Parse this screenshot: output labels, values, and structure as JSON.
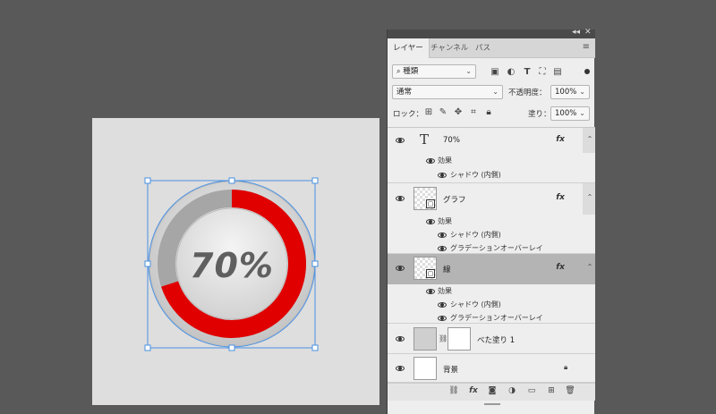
{
  "canvas": {
    "progress_text": "70%",
    "progress_fraction": 0.7,
    "ring_color": "#e00000",
    "track_color": "#a6a6a6"
  },
  "panel": {
    "collapse": "◂◂",
    "close": "✕",
    "tabs": [
      "レイヤー",
      "チャンネル",
      "パス"
    ],
    "menu_icon": "≡",
    "filter": {
      "label": "種類",
      "search_icon": "🔍"
    },
    "blend_mode": "通常",
    "opacity_label": "不透明度：",
    "opacity_value": "100%",
    "lock_label": "ロック：",
    "fill_label": "塗り：",
    "fill_value": "100%"
  },
  "layers": [
    {
      "name": "70%",
      "type_glyph": "T",
      "fx": "fx",
      "effects_label": "効果",
      "effects": [
        "シャドウ (内側)"
      ]
    },
    {
      "name": "グラフ",
      "fx": "fx",
      "effects_label": "効果",
      "effects": [
        "シャドウ (内側)",
        "グラデーションオーバーレイ"
      ]
    },
    {
      "name": "線",
      "fx": "fx",
      "effects_label": "効果",
      "effects": [
        "シャドウ (内側)",
        "グラデーションオーバーレイ"
      ]
    },
    {
      "name": "べた塗り 1"
    },
    {
      "name": "背景"
    }
  ],
  "colors": {
    "app_bg": "#595959",
    "panel_bg": "#eeeeee",
    "selected_bg": "#b4b4b4",
    "selection_blue": "#4a90e2"
  }
}
